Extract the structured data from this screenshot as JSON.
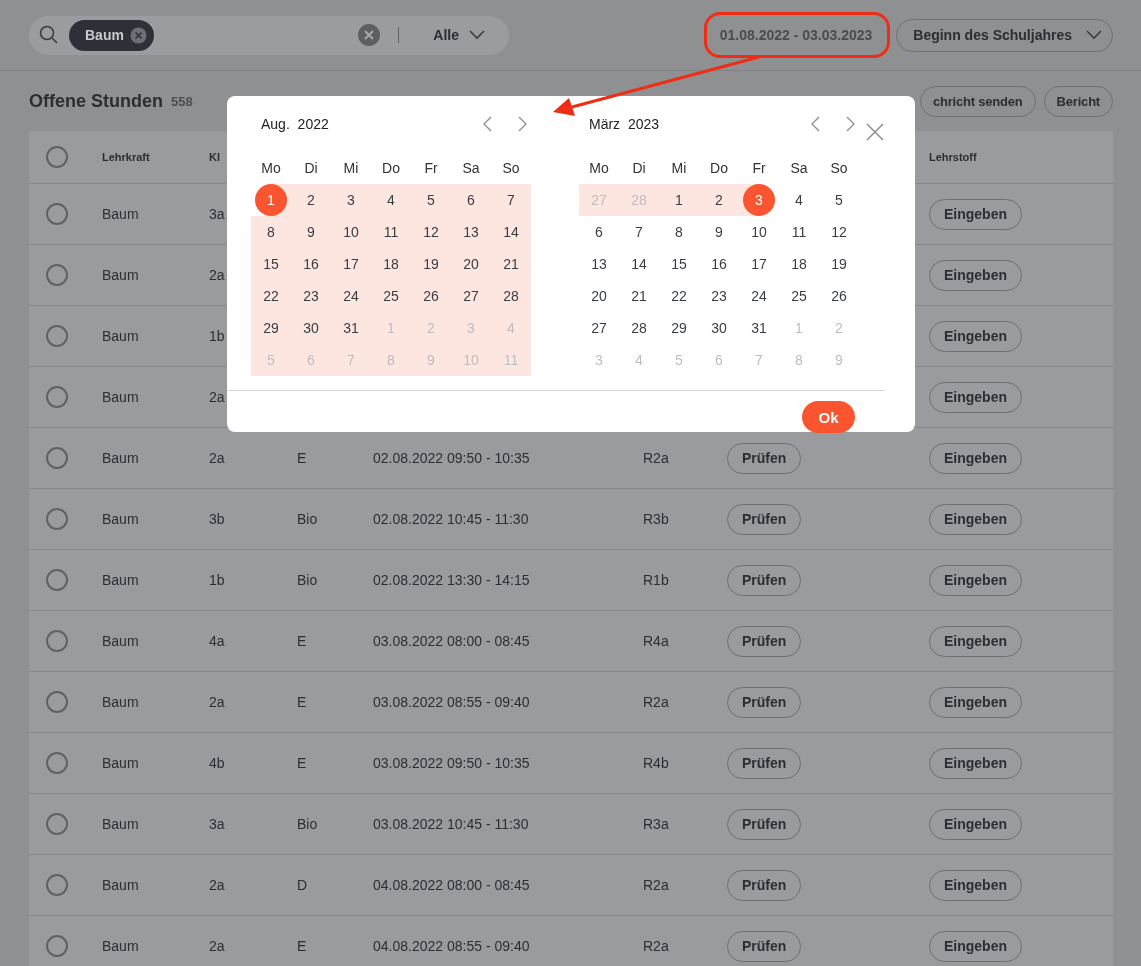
{
  "search": {
    "chip": "Baum",
    "filter": "Alle"
  },
  "date_range": {
    "value": "01.08.2022 - 03.03.2023",
    "highlighted": true
  },
  "period_button": "Beginn des Schuljahres",
  "section": {
    "title": "Offene Stunden",
    "count": "558",
    "buttons": [
      "chricht senden",
      "Bericht"
    ]
  },
  "table": {
    "header": {
      "selected": false,
      "column_1": "Lehrkraft",
      "column_2": "Kl",
      "column_8": "Lehrstoff"
    },
    "rows": [
      {
        "selected": false,
        "teacher": "Baum",
        "class": "3a",
        "action": "Eingeben"
      },
      {
        "selected": false,
        "teacher": "Baum",
        "class": "2a",
        "action": "Eingeben"
      },
      {
        "selected": false,
        "teacher": "Baum",
        "class": "1b",
        "action": "Eingeben"
      },
      {
        "selected": false,
        "teacher": "Baum",
        "class": "2a",
        "action": "Eingeben"
      },
      {
        "selected": false,
        "teacher": "Baum",
        "class": "2a",
        "subject": "E",
        "time": "02.08.2022 09:50 - 10:35",
        "room": "R2a",
        "check": "Prüfen",
        "action": "Eingeben"
      },
      {
        "selected": false,
        "teacher": "Baum",
        "class": "3b",
        "subject": "Bio",
        "time": "02.08.2022 10:45 - 11:30",
        "room": "R3b",
        "check": "Prüfen",
        "action": "Eingeben"
      },
      {
        "selected": false,
        "teacher": "Baum",
        "class": "1b",
        "subject": "Bio",
        "time": "02.08.2022 13:30 - 14:15",
        "room": "R1b",
        "check": "Prüfen",
        "action": "Eingeben"
      },
      {
        "selected": false,
        "teacher": "Baum",
        "class": "4a",
        "subject": "E",
        "time": "03.08.2022 08:00 - 08:45",
        "room": "R4a",
        "check": "Prüfen",
        "action": "Eingeben"
      },
      {
        "selected": false,
        "teacher": "Baum",
        "class": "2a",
        "subject": "E",
        "time": "03.08.2022 08:55 - 09:40",
        "room": "R2a",
        "check": "Prüfen",
        "action": "Eingeben"
      },
      {
        "selected": false,
        "teacher": "Baum",
        "class": "4b",
        "subject": "E",
        "time": "03.08.2022 09:50 - 10:35",
        "room": "R4b",
        "check": "Prüfen",
        "action": "Eingeben"
      },
      {
        "selected": false,
        "teacher": "Baum",
        "class": "3a",
        "subject": "Bio",
        "time": "03.08.2022 10:45 - 11:30",
        "room": "R3a",
        "check": "Prüfen",
        "action": "Eingeben"
      },
      {
        "selected": false,
        "teacher": "Baum",
        "class": "2a",
        "subject": "D",
        "time": "04.08.2022 08:00 - 08:45",
        "room": "R2a",
        "check": "Prüfen",
        "action": "Eingeben"
      },
      {
        "selected": false,
        "teacher": "Baum",
        "class": "2a",
        "subject": "E",
        "time": "04.08.2022 08:55 - 09:40",
        "room": "R2a",
        "check": "Prüfen",
        "action": "Eingeben"
      }
    ]
  },
  "calendar": {
    "ok": "Ok",
    "months": [
      {
        "month": "Aug.",
        "year": "2022",
        "weekdays": [
          "Mo",
          "Di",
          "Mi",
          "Do",
          "Fr",
          "Sa",
          "So"
        ],
        "days": [
          {
            "day": "1",
            "outside": false,
            "in_range": true,
            "selected": true
          },
          {
            "day": "2",
            "outside": false,
            "in_range": true,
            "selected": false
          },
          {
            "day": "3",
            "outside": false,
            "in_range": true,
            "selected": false
          },
          {
            "day": "4",
            "outside": false,
            "in_range": true,
            "selected": false
          },
          {
            "day": "5",
            "outside": false,
            "in_range": true,
            "selected": false
          },
          {
            "day": "6",
            "outside": false,
            "in_range": true,
            "selected": false
          },
          {
            "day": "7",
            "outside": false,
            "in_range": true,
            "selected": false
          },
          {
            "day": "8",
            "outside": false,
            "in_range": true,
            "selected": false
          },
          {
            "day": "9",
            "outside": false,
            "in_range": true,
            "selected": false
          },
          {
            "day": "10",
            "outside": false,
            "in_range": true,
            "selected": false
          },
          {
            "day": "11",
            "outside": false,
            "in_range": true,
            "selected": false
          },
          {
            "day": "12",
            "outside": false,
            "in_range": true,
            "selected": false
          },
          {
            "day": "13",
            "outside": false,
            "in_range": true,
            "selected": false
          },
          {
            "day": "14",
            "outside": false,
            "in_range": true,
            "selected": false
          },
          {
            "day": "15",
            "outside": false,
            "in_range": true,
            "selected": false
          },
          {
            "day": "16",
            "outside": false,
            "in_range": true,
            "selected": false
          },
          {
            "day": "17",
            "outside": false,
            "in_range": true,
            "selected": false
          },
          {
            "day": "18",
            "outside": false,
            "in_range": true,
            "selected": false
          },
          {
            "day": "19",
            "outside": false,
            "in_range": true,
            "selected": false
          },
          {
            "day": "20",
            "outside": false,
            "in_range": true,
            "selected": false
          },
          {
            "day": "21",
            "outside": false,
            "in_range": true,
            "selected": false
          },
          {
            "day": "22",
            "outside": false,
            "in_range": true,
            "selected": false
          },
          {
            "day": "23",
            "outside": false,
            "in_range": true,
            "selected": false
          },
          {
            "day": "24",
            "outside": false,
            "in_range": true,
            "selected": false
          },
          {
            "day": "25",
            "outside": false,
            "in_range": true,
            "selected": false
          },
          {
            "day": "26",
            "outside": false,
            "in_range": true,
            "selected": false
          },
          {
            "day": "27",
            "outside": false,
            "in_range": true,
            "selected": false
          },
          {
            "day": "28",
            "outside": false,
            "in_range": true,
            "selected": false
          },
          {
            "day": "29",
            "outside": false,
            "in_range": true,
            "selected": false
          },
          {
            "day": "30",
            "outside": false,
            "in_range": true,
            "selected": false
          },
          {
            "day": "31",
            "outside": false,
            "in_range": true,
            "selected": false
          },
          {
            "day": "1",
            "outside": true,
            "in_range": true,
            "selected": false
          },
          {
            "day": "2",
            "outside": true,
            "in_range": true,
            "selected": false
          },
          {
            "day": "3",
            "outside": true,
            "in_range": true,
            "selected": false
          },
          {
            "day": "4",
            "outside": true,
            "in_range": true,
            "selected": false
          },
          {
            "day": "5",
            "outside": true,
            "in_range": true,
            "selected": false
          },
          {
            "day": "6",
            "outside": true,
            "in_range": true,
            "selected": false
          },
          {
            "day": "7",
            "outside": true,
            "in_range": true,
            "selected": false
          },
          {
            "day": "8",
            "outside": true,
            "in_range": true,
            "selected": false
          },
          {
            "day": "9",
            "outside": true,
            "in_range": true,
            "selected": false
          },
          {
            "day": "10",
            "outside": true,
            "in_range": true,
            "selected": false
          },
          {
            "day": "11",
            "outside": true,
            "in_range": true,
            "selected": false
          }
        ]
      },
      {
        "month": "März",
        "year": "2023",
        "weekdays": [
          "Mo",
          "Di",
          "Mi",
          "Do",
          "Fr",
          "Sa",
          "So"
        ],
        "days": [
          {
            "day": "27",
            "outside": true,
            "in_range": true,
            "selected": false
          },
          {
            "day": "28",
            "outside": true,
            "in_range": true,
            "selected": false
          },
          {
            "day": "1",
            "outside": false,
            "in_range": true,
            "selected": false
          },
          {
            "day": "2",
            "outside": false,
            "in_range": true,
            "selected": false
          },
          {
            "day": "3",
            "outside": false,
            "in_range": true,
            "selected": true
          },
          {
            "day": "4",
            "outside": false,
            "in_range": false,
            "selected": false
          },
          {
            "day": "5",
            "outside": false,
            "in_range": false,
            "selected": false
          },
          {
            "day": "6",
            "outside": false,
            "in_range": false,
            "selected": false
          },
          {
            "day": "7",
            "outside": false,
            "in_range": false,
            "selected": false
          },
          {
            "day": "8",
            "outside": false,
            "in_range": false,
            "selected": false
          },
          {
            "day": "9",
            "outside": false,
            "in_range": false,
            "selected": false
          },
          {
            "day": "10",
            "outside": false,
            "in_range": false,
            "selected": false
          },
          {
            "day": "11",
            "outside": false,
            "in_range": false,
            "selected": false
          },
          {
            "day": "12",
            "outside": false,
            "in_range": false,
            "selected": false
          },
          {
            "day": "13",
            "outside": false,
            "in_range": false,
            "selected": false
          },
          {
            "day": "14",
            "outside": false,
            "in_range": false,
            "selected": false
          },
          {
            "day": "15",
            "outside": false,
            "in_range": false,
            "selected": false
          },
          {
            "day": "16",
            "outside": false,
            "in_range": false,
            "selected": false
          },
          {
            "day": "17",
            "outside": false,
            "in_range": false,
            "selected": false
          },
          {
            "day": "18",
            "outside": false,
            "in_range": false,
            "selected": false
          },
          {
            "day": "19",
            "outside": false,
            "in_range": false,
            "selected": false
          },
          {
            "day": "20",
            "outside": false,
            "in_range": false,
            "selected": false
          },
          {
            "day": "21",
            "outside": false,
            "in_range": false,
            "selected": false
          },
          {
            "day": "22",
            "outside": false,
            "in_range": false,
            "selected": false
          },
          {
            "day": "23",
            "outside": false,
            "in_range": false,
            "selected": false
          },
          {
            "day": "24",
            "outside": false,
            "in_range": false,
            "selected": false
          },
          {
            "day": "25",
            "outside": false,
            "in_range": false,
            "selected": false
          },
          {
            "day": "26",
            "outside": false,
            "in_range": false,
            "selected": false
          },
          {
            "day": "27",
            "outside": false,
            "in_range": false,
            "selected": false
          },
          {
            "day": "28",
            "outside": false,
            "in_range": false,
            "selected": false
          },
          {
            "day": "29",
            "outside": false,
            "in_range": false,
            "selected": false
          },
          {
            "day": "30",
            "outside": false,
            "in_range": false,
            "selected": false
          },
          {
            "day": "31",
            "outside": false,
            "in_range": false,
            "selected": false
          },
          {
            "day": "1",
            "outside": true,
            "in_range": false,
            "selected": false
          },
          {
            "day": "2",
            "outside": true,
            "in_range": false,
            "selected": false
          },
          {
            "day": "3",
            "outside": true,
            "in_range": false,
            "selected": false
          },
          {
            "day": "4",
            "outside": true,
            "in_range": false,
            "selected": false
          },
          {
            "day": "5",
            "outside": true,
            "in_range": false,
            "selected": false
          },
          {
            "day": "6",
            "outside": true,
            "in_range": false,
            "selected": false
          },
          {
            "day": "7",
            "outside": true,
            "in_range": false,
            "selected": false
          },
          {
            "day": "8",
            "outside": true,
            "in_range": false,
            "selected": false
          },
          {
            "day": "9",
            "outside": true,
            "in_range": false,
            "selected": false
          }
        ]
      }
    ]
  }
}
